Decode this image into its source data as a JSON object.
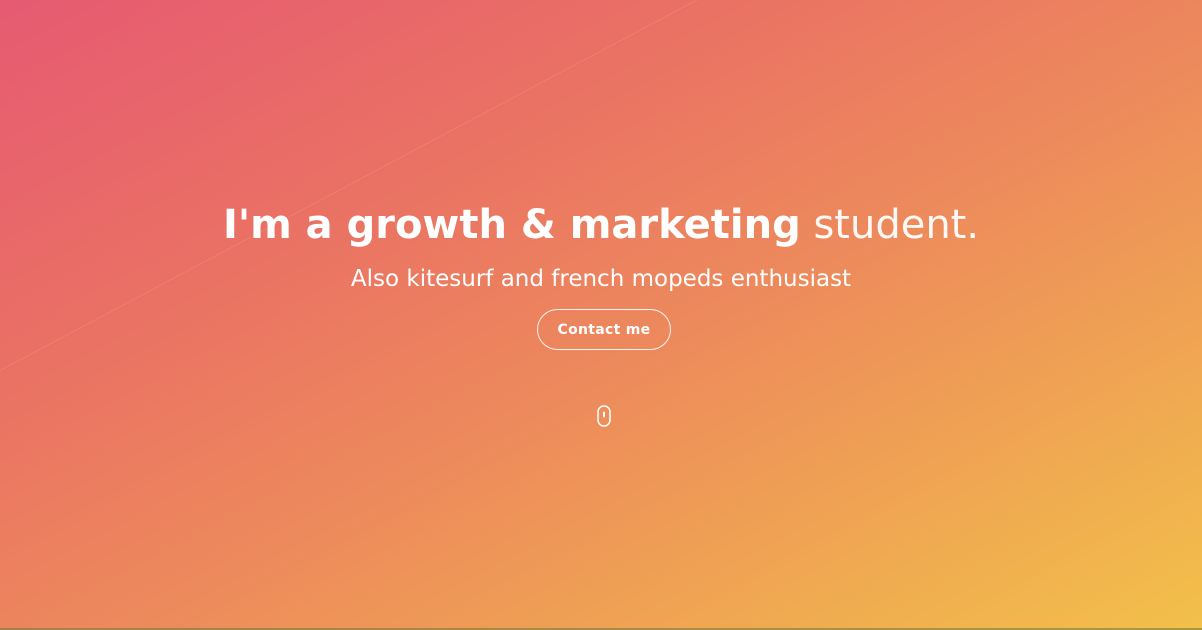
{
  "hero": {
    "headline_strong": "I'm a growth & marketing",
    "headline_light": "student.",
    "subheadline": "Also kitesurf and french mopeds enthusiast",
    "contact_button_label": "Contact me",
    "scroll_icon": "mouse-scroll-icon"
  },
  "colors": {
    "gradient_start": "#e65a72",
    "gradient_end": "#f2c04a",
    "text": "#ffffff"
  }
}
